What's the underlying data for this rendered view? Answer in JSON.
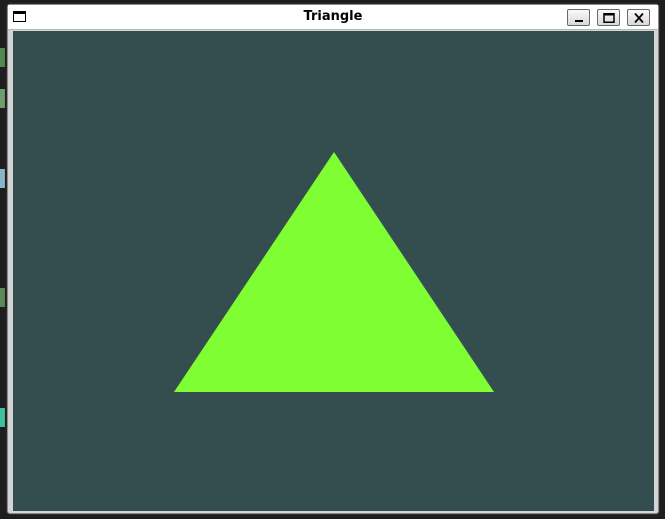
{
  "window": {
    "title": "Triangle",
    "icons": {
      "app": "window-icon",
      "minimize": "minimize-icon",
      "maximize": "maximize-icon",
      "close": "close-icon"
    }
  },
  "canvas": {
    "background_color": "#344e4f",
    "shape": "triangle",
    "fill_color": "#7fff33"
  },
  "background_terminal": {
    "colors": [
      "#5a8a5a",
      "#6aa06a",
      "#8ab4c8",
      "#40c0a0"
    ]
  }
}
